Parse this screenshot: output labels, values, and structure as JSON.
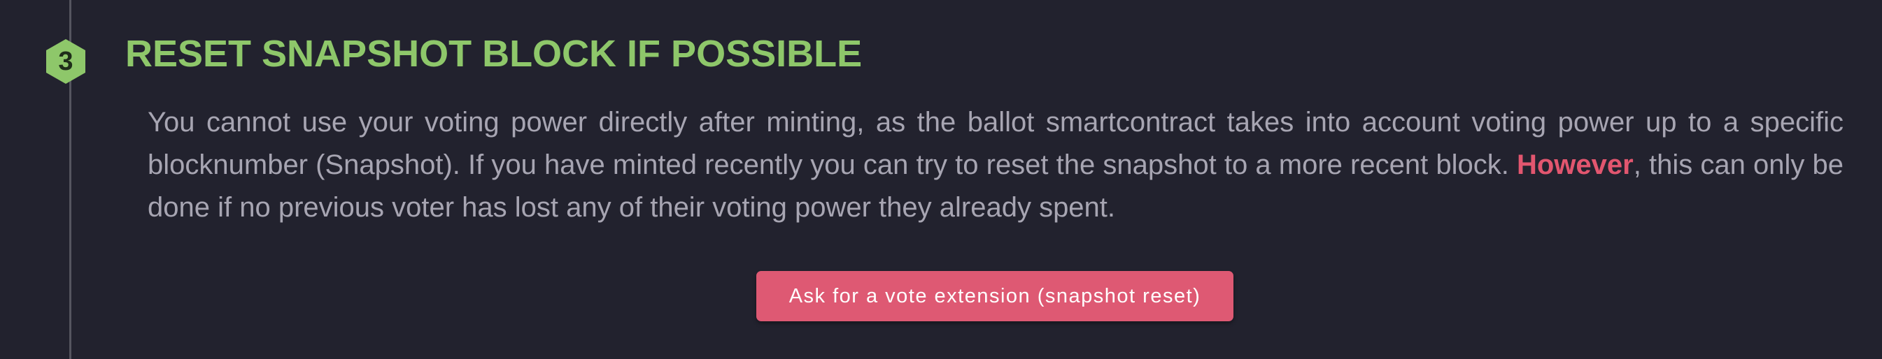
{
  "step": {
    "number": "3",
    "title": "RESET SNAPSHOT BLOCK IF POSSIBLE",
    "body_before": "You cannot use your voting power directly after minting, as the ballot smartcontract takes into account voting power up to a specific blocknumber (Snapshot). If you have minted recently you can try to reset the snapshot to a more recent block. ",
    "body_highlight": "However",
    "body_after": ", this can only be done if no previous voter has lost any of their voting power they already spent.",
    "button_label": "Ask for a vote extension (snapshot reset)"
  },
  "colors": {
    "background": "#22222e",
    "title_green": "#8ec76a",
    "body_text": "#a7a5b2",
    "accent_red": "#de5973"
  },
  "icons": {
    "step_badge": "hexagon-number-icon"
  }
}
